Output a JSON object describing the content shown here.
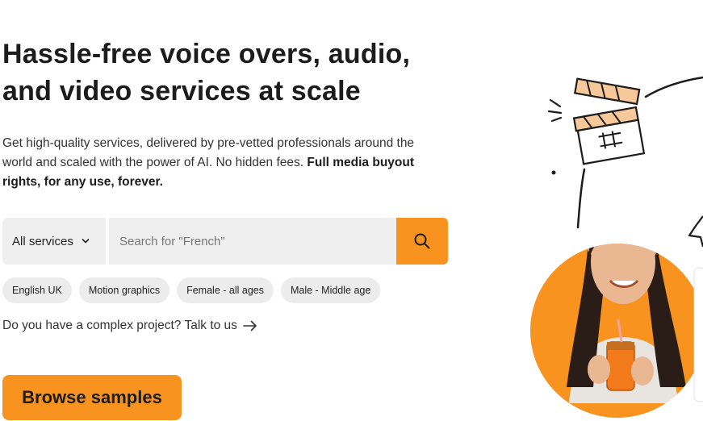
{
  "hero": {
    "title_line1": "Hassle-free voice overs, audio,",
    "title_line2": "and video services at scale",
    "subtitle_plain": "Get high-quality services, delivered by pre-vetted professionals around the world and scaled with the power of AI. No hidden fees. ",
    "subtitle_bold": "Full media buyout rights, for any use, forever."
  },
  "search": {
    "service_select": "All services",
    "placeholder": "Search for \"French\"",
    "search_icon": "search-icon"
  },
  "chips": [
    "English UK",
    "Motion graphics",
    "Female - all ages",
    "Male - Middle age"
  ],
  "talk_link": "Do you have a complex project? Talk to us",
  "browse_button": "Browse samples",
  "colors": {
    "accent": "#f7931e",
    "field_bg": "#efefef",
    "chip_bg": "#ececec"
  }
}
